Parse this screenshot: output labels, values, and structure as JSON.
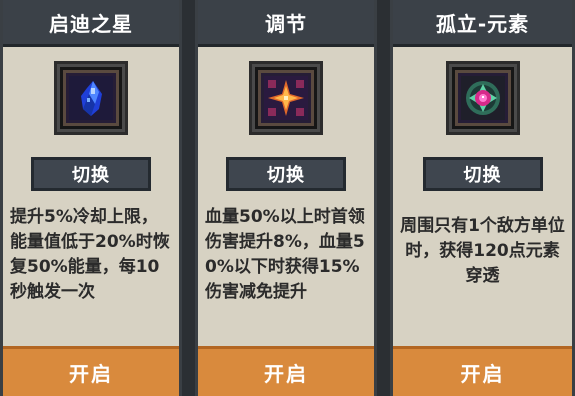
{
  "cards": [
    {
      "title": "启迪之星",
      "icon": "blue-crystal-icon",
      "switch_label": "切换",
      "description": "提升5%冷却上限，能量值低于20%时恢复50%能量，每10秒触发一次",
      "open_label": "开启"
    },
    {
      "title": "调节",
      "icon": "orange-star-icon",
      "switch_label": "切换",
      "description": "血量50%以上时首领伤害提升8%，血量50%以下时获得15%伤害减免提升",
      "open_label": "开启"
    },
    {
      "title": "孤立-元素",
      "icon": "pink-element-orb-icon",
      "switch_label": "切换",
      "description": "周围只有1个敌方单位时，获得120点元素穿透",
      "open_label": "开启"
    }
  ],
  "colors": {
    "header": "#3b4148",
    "card_bg": "#d7d2c3",
    "switch_button": "#3f464f",
    "open_button": "#d98a3d"
  }
}
